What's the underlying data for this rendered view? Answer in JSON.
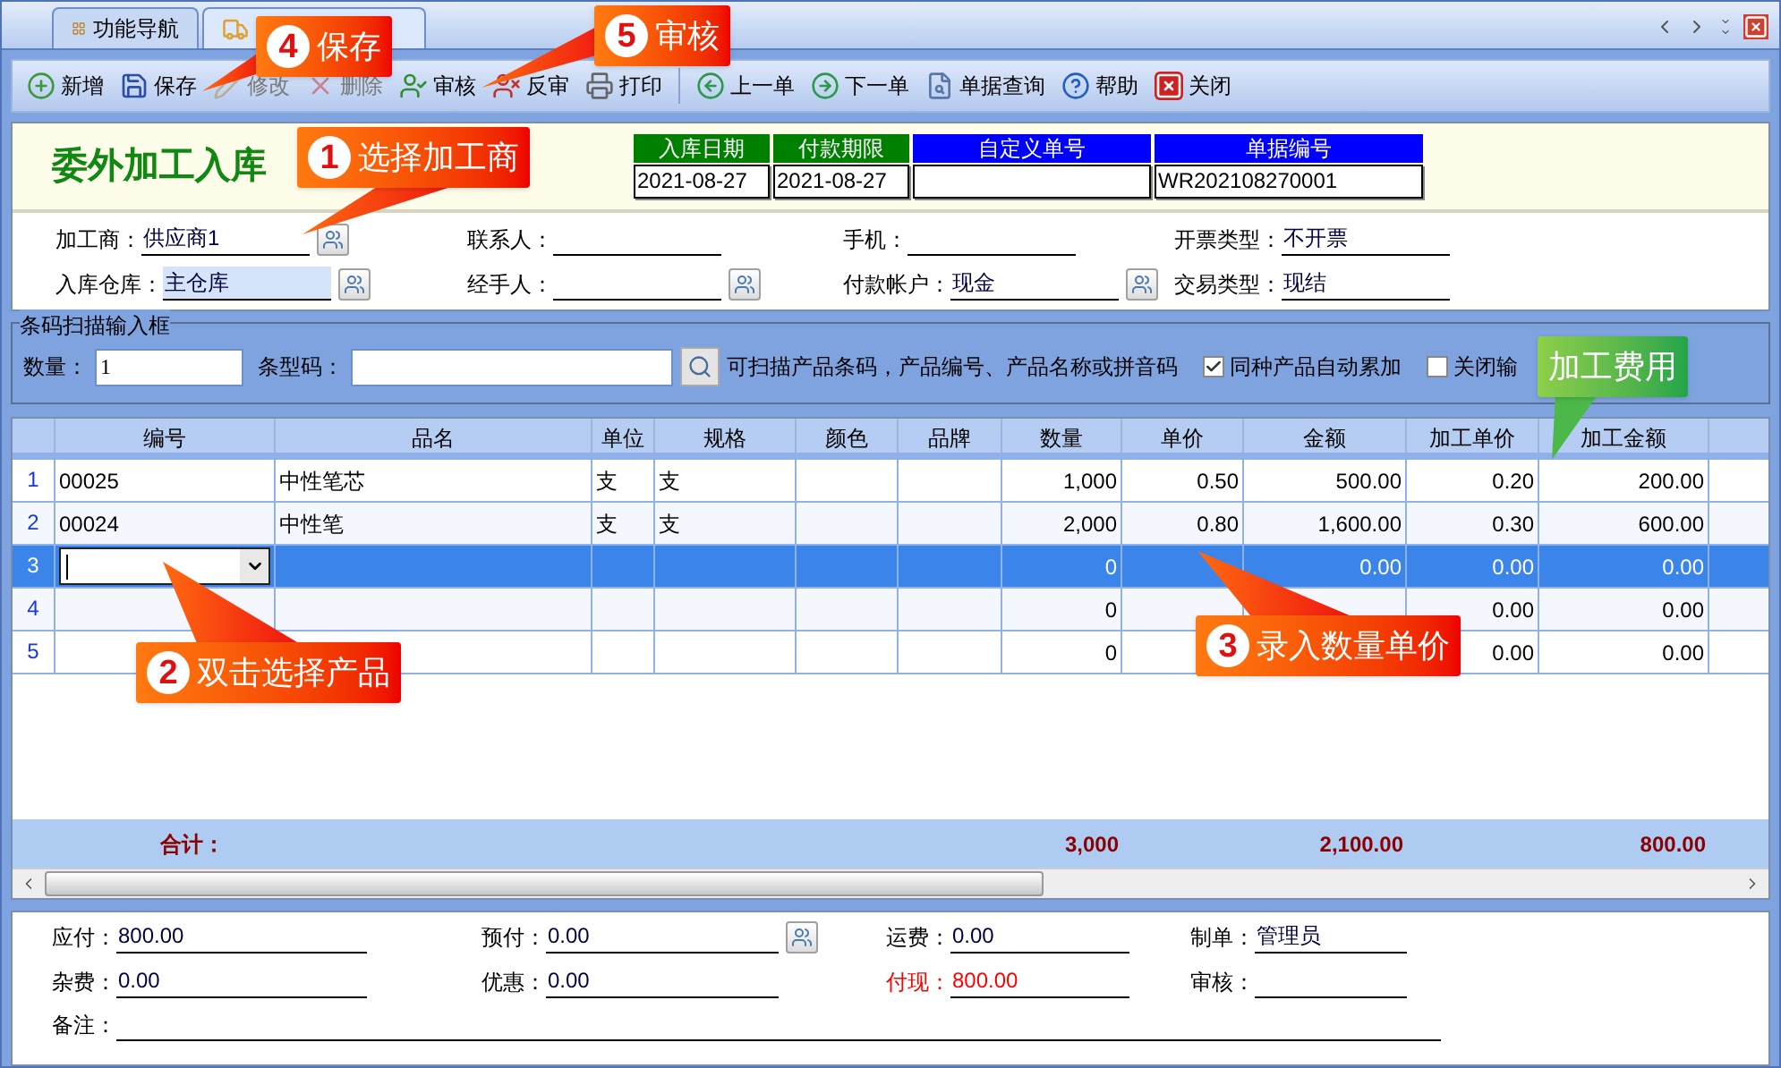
{
  "tabs": [
    {
      "label": "功能导航",
      "selected": false,
      "kind": "nav"
    },
    {
      "selected": true,
      "kind": "doc"
    }
  ],
  "toolbar": [
    {
      "label": "新增",
      "kind": "add",
      "disabled": false
    },
    {
      "label": "保存",
      "kind": "save",
      "disabled": false
    },
    {
      "label": "修改",
      "kind": "edit",
      "disabled": true
    },
    {
      "label": "删除",
      "kind": "delete",
      "disabled": true
    },
    {
      "label": "审核",
      "kind": "approve",
      "disabled": false
    },
    {
      "label": "反审",
      "kind": "unapprove",
      "disabled": false
    },
    {
      "label": "打印",
      "kind": "print",
      "disabled": false
    },
    {
      "kind": "separator"
    },
    {
      "label": "上一单",
      "kind": "prev",
      "disabled": false
    },
    {
      "label": "下一单",
      "kind": "next",
      "disabled": false
    },
    {
      "label": "单据查询",
      "kind": "query",
      "disabled": false
    },
    {
      "label": "帮助",
      "kind": "help",
      "disabled": false
    },
    {
      "label": "关闭",
      "kind": "close",
      "disabled": false
    }
  ],
  "document": {
    "title": "委外加工入库",
    "header_fields": [
      {
        "label": "入库日期",
        "value": "2021-08-27",
        "color": "#008000"
      },
      {
        "label": "付款期限",
        "value": "2021-08-27",
        "color": "#008000"
      },
      {
        "label": "自定义单号",
        "color": "#0000ff"
      },
      {
        "label": "单据编号",
        "value": "WR202108270001",
        "color": "#0000ff"
      }
    ]
  },
  "form_rows": [
    [
      {
        "label": "加工商：",
        "value": "供应商1",
        "lookup": true,
        "highlighted": false
      },
      {
        "label": "联系人：",
        "lookup": false,
        "highlighted": false
      },
      {
        "label": "手机：",
        "lookup": false,
        "highlighted": false
      },
      {
        "label": "开票类型：",
        "value": "不开票",
        "lookup": false,
        "highlighted": false
      }
    ],
    [
      {
        "label": "入库仓库：",
        "value": "主仓库",
        "lookup": true,
        "highlighted": true
      },
      {
        "label": "经手人：",
        "lookup": true,
        "highlighted": false
      },
      {
        "label": "付款帐户：",
        "value": "现金",
        "lookup": true,
        "highlighted": false
      },
      {
        "label": "交易类型：",
        "value": "现结",
        "lookup": false,
        "highlighted": false
      }
    ]
  ],
  "barcode_panel": {
    "title": "条码扫描输入框",
    "quantity_label": "数量：",
    "quantity_value": "1",
    "barcode_label": "条型码：",
    "hint": "可扫描产品条码，产品编号、产品名称或拼音码",
    "options": [
      {
        "label": "同种产品自动累加",
        "checked": true
      },
      {
        "label": "关闭输",
        "checked": false
      }
    ]
  },
  "grid": {
    "columns": [
      "编号",
      "品名",
      "单位",
      "规格",
      "颜色",
      "品牌",
      "数量",
      "单价",
      "金额",
      "加工单价",
      "加工金额"
    ],
    "rows": [
      {
        "number": "1",
        "selected": false,
        "editing": false,
        "cells": [
          "00025",
          "中性笔芯",
          "支",
          "支",
          null,
          null,
          "1,000",
          "0.50",
          "500.00",
          "0.20",
          "200.00"
        ]
      },
      {
        "number": "2",
        "selected": false,
        "editing": false,
        "cells": [
          "00024",
          "中性笔",
          "支",
          "支",
          null,
          null,
          "2,000",
          "0.80",
          "1,600.00",
          "0.30",
          "600.00"
        ]
      },
      {
        "number": "3",
        "selected": true,
        "editing": true,
        "cells": [
          null,
          null,
          null,
          null,
          null,
          null,
          "0",
          null,
          "0.00",
          "0.00",
          "0.00"
        ]
      },
      {
        "number": "4",
        "selected": false,
        "editing": false,
        "cells": [
          null,
          null,
          null,
          null,
          null,
          null,
          "0",
          null,
          null,
          "0.00",
          "0.00"
        ]
      },
      {
        "number": "5",
        "selected": false,
        "editing": false,
        "cells": [
          null,
          null,
          null,
          null,
          null,
          null,
          "0",
          null,
          null,
          "0.00",
          "0.00"
        ]
      }
    ],
    "totals": {
      "label": "合计：",
      "cells": [
        null,
        null,
        null,
        null,
        null,
        null,
        "3,000",
        null,
        "2,100.00",
        null,
        "800.00"
      ]
    }
  },
  "summary_rows": [
    [
      {
        "label": "应付：",
        "value": "800.00",
        "lookup": false,
        "emphasis": false
      },
      {
        "label": "预付：",
        "value": "0.00",
        "lookup": true,
        "emphasis": false
      },
      {
        "label": "运费：",
        "value": "0.00",
        "lookup": false,
        "emphasis": false
      },
      {
        "label": "制单：",
        "value": "管理员",
        "lookup": false,
        "emphasis": false
      }
    ],
    [
      {
        "label": "杂费：",
        "value": "0.00",
        "lookup": false,
        "emphasis": false
      },
      {
        "label": "优惠：",
        "value": "0.00",
        "lookup": false,
        "emphasis": false
      },
      {
        "label": "付现：",
        "value": "800.00",
        "lookup": false,
        "emphasis": true
      },
      {
        "label": "审核：",
        "lookup": false,
        "emphasis": false
      }
    ]
  ],
  "remark": {
    "label": "备注："
  },
  "callouts": [
    {
      "kind": "step",
      "number": "4",
      "text": "保存"
    },
    {
      "kind": "step",
      "number": "5",
      "text": "审核"
    },
    {
      "kind": "step",
      "number": "1",
      "text": "选择加工商"
    },
    {
      "kind": "step",
      "number": "2",
      "text": "双击选择产品"
    },
    {
      "kind": "step",
      "number": "3",
      "text": "录入数量单价"
    },
    {
      "kind": "note",
      "text": "加工费用"
    }
  ]
}
